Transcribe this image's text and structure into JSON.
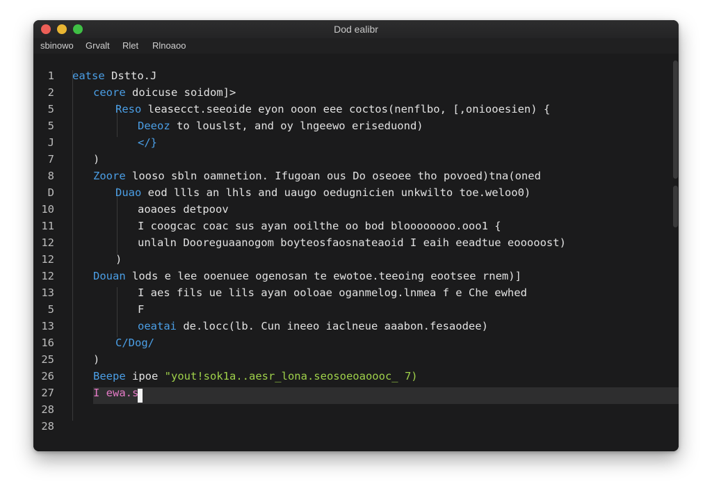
{
  "window": {
    "title": "Dod ealibr"
  },
  "menu": [
    "sbinowo",
    "Grvalt",
    "Rlet",
    "Rlnoaoo"
  ],
  "gutter_numbers": [
    "1",
    "2",
    "5",
    "5",
    "J",
    "7",
    "8",
    "D",
    "10",
    "11",
    "12",
    "12",
    "12",
    "13",
    "5",
    "13",
    "16",
    "25",
    "26",
    "27",
    "28",
    "28"
  ],
  "code": [
    {
      "text": "eatse Dstto.J",
      "kind": "kw-first"
    },
    {
      "text": "ceore doicuse soidom]>",
      "kind": "mixed"
    },
    {
      "text": "Reso leasecct.seeoide eyon ooon eee coctos(nenflbo, [,oniooesien) {",
      "kind": "mixed"
    },
    {
      "text": "Deeoz to louslst, and oy lngeewo eriseduond)",
      "kind": "mixed"
    },
    {
      "text": "</}",
      "kind": "kw"
    },
    {
      "text": ")",
      "kind": "plain"
    },
    {
      "text": "Zoore looso sbln oamnetion. Ifugoan ous Do oseoee tho povoed)tna(oned",
      "kind": "mixed"
    },
    {
      "text": "Duao eod llls an lhls and uaugo oedugnicien unkwilto toe.weloo0)",
      "kind": "mixed"
    },
    {
      "text": "aoaoes detpoov",
      "kind": "plain"
    },
    {
      "text": "I coogcac coac sus ayan ooilthe oo bod bloooooooo.ooo1 {",
      "kind": "plain"
    },
    {
      "text": "unlaln Dooreguaanogom boyteosfaosnateaoid I eaih eeadtue eooooost)",
      "kind": "plain"
    },
    {
      "text": ")",
      "kind": "plain"
    },
    {
      "text": "Douan lods e lee ooenuee ogenosan te ewotoe.teeoing eootsee rnem)]",
      "kind": "mixed"
    },
    {
      "text": "I aes fils ue lils ayan ooloae oganmelog.lnmea f e Che ewhed",
      "kind": "plain"
    },
    {
      "text": "F",
      "kind": "plain"
    },
    {
      "text": "oeatai de.locc(lb. Cun ineeo iaclneue aaabon.fesaodee)",
      "kind": "mixed"
    },
    {
      "text": "C/Dog/",
      "kind": "kw"
    },
    {
      "text": ")",
      "kind": "plain"
    },
    {
      "text": "Beepe ipoe \"yout!sok1a..aesr_lona.seosoeoaoooc_ 7)",
      "kind": "mixed"
    },
    {
      "text": "I ewa.s",
      "kind": "pink"
    },
    {
      "text": "",
      "kind": "plain"
    },
    {
      "text": "",
      "kind": "plain"
    }
  ],
  "colors": {
    "keyword": "#4b9fe6",
    "string": "#9fd14a",
    "text": "#e2e2e2",
    "background": "#1b1b1c",
    "current_line": "#2e2e2f"
  }
}
